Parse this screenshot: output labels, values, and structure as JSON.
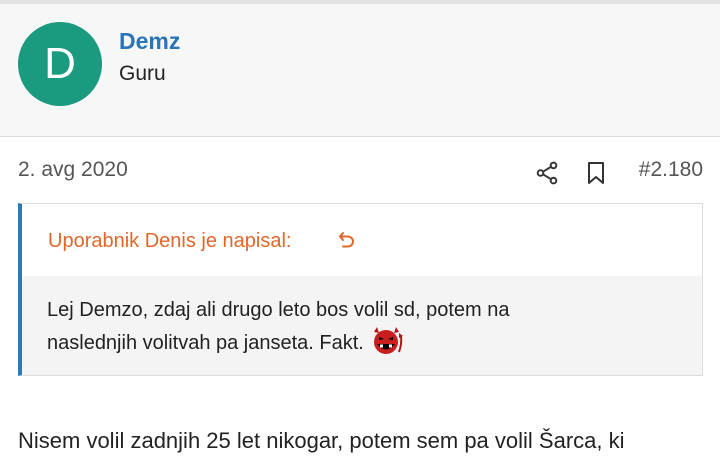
{
  "user": {
    "avatar_letter": "D",
    "name": "Demz",
    "title": "Guru",
    "avatar_color": "#1a9a7e",
    "name_color": "#2a73b5"
  },
  "post": {
    "date": "2. avg 2020",
    "number": "#2.180",
    "icons": [
      "share-icon",
      "bookmark-icon"
    ]
  },
  "quote": {
    "author_line": "Uporabnik Denis je napisal:",
    "line1": "Lej Demzo, zdaj ali drugo leto bos volil sd, potem na",
    "line2": "naslednjih volitvah pa janseta. Fakt.",
    "emoji": "devil-smiley-icon",
    "accent_color": "#e0672a"
  },
  "body": {
    "text": "Nisem volil zadnjih 25 let nikogar, potem sem pa volil Šarca, ki"
  }
}
